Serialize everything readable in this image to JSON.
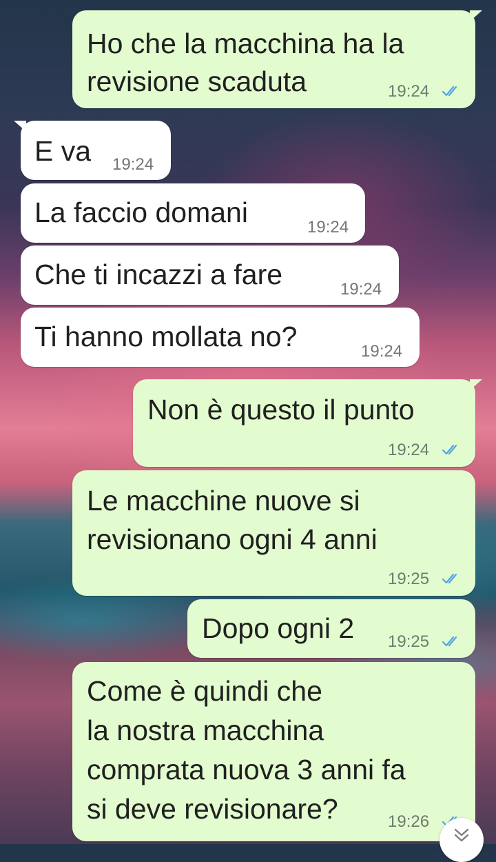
{
  "messages": [
    {
      "dir": "out",
      "lines": [
        "Ho che la macchina ha la",
        "revisione scaduta"
      ],
      "time": "19:24",
      "status": "read"
    },
    {
      "dir": "in",
      "lines": [
        "E va"
      ],
      "time": "19:24"
    },
    {
      "dir": "in",
      "lines": [
        "La faccio domani"
      ],
      "time": "19:24"
    },
    {
      "dir": "in",
      "lines": [
        "Che ti incazzi a fare"
      ],
      "time": "19:24"
    },
    {
      "dir": "in",
      "lines": [
        "Ti hanno mollata no?"
      ],
      "time": "19:24"
    },
    {
      "dir": "out",
      "lines": [
        "Non è questo il punto"
      ],
      "time": "19:24",
      "status": "read"
    },
    {
      "dir": "out",
      "lines": [
        "Le macchine nuove si",
        "revisionano ogni 4 anni"
      ],
      "time": "19:25",
      "status": "read"
    },
    {
      "dir": "out",
      "lines": [
        "Dopo ogni 2"
      ],
      "time": "19:25",
      "status": "read"
    },
    {
      "dir": "out",
      "lines": [
        "Come è quindi che",
        "la nostra macchina",
        "comprata nuova 3 anni fa",
        "si deve revisionare?"
      ],
      "time": "19:26",
      "status": "read"
    }
  ],
  "colors": {
    "outgoing_bubble": "#e2fbcf",
    "incoming_bubble": "#ffffff",
    "read_ticks": "#4fa6e6",
    "timestamp": "#6f7b70"
  },
  "icons": {
    "read_status": "double-check-icon",
    "scroll_down": "double-chevron-down-icon"
  }
}
